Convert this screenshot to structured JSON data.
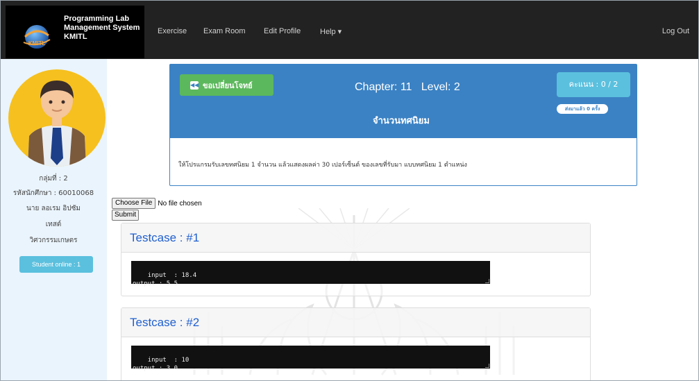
{
  "app": {
    "brand_line1": "Programming Lab",
    "brand_line2": "Management System",
    "brand_line3": "KMITL",
    "logo_text": "KMITL"
  },
  "nav": {
    "items": [
      {
        "label": "Exercise"
      },
      {
        "label": "Exam Room"
      },
      {
        "label": "Edit Profile"
      },
      {
        "label": "Help ▾"
      }
    ],
    "logout": "Log Out"
  },
  "sidebar": {
    "group": "กลุ่มที่ : 2",
    "student_id": "รหัสนักศึกษา : 60010068",
    "name": "นาย ลอเรม อิปซัม",
    "nickname": "เทสต์",
    "faculty": "วิศวกรรมเกษตร",
    "online_button": "Student online : 1"
  },
  "exercise": {
    "change_button": "ขอเปลี่ยนโจทย์",
    "chapter_label": "Chapter: 11",
    "level_label": "Level: 2",
    "title": "จำนวนทศนิยม",
    "score": "คะแนน : 0 / 2",
    "submitted": "ส่งมาแล้ว 0 ครั้ง",
    "problem_text": "ให้โปรแกรมรับเลขทศนิยม 1 จำนวน แล้วแสดงผลค่า 30 เปอร์เซ็นต์ ของเลขที่รับมา แบบทศนิยม 1 ตำแหน่ง"
  },
  "upload": {
    "choose_file": "Choose File",
    "no_file": "No file chosen",
    "submit": "Submit"
  },
  "testcases": [
    {
      "title": "Testcase : #1",
      "io": "input  : 18.4\noutput : 5.5"
    },
    {
      "title": "Testcase : #2",
      "io": "input  : 10\noutput : 3.0"
    }
  ],
  "colors": {
    "navbar": "#222222",
    "panel_blue": "#3b82c4",
    "green": "#5cb85c",
    "info": "#5bc0de",
    "sidebar_bg": "#eaf4fc"
  }
}
